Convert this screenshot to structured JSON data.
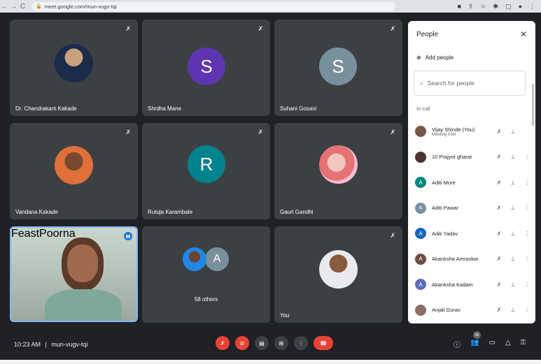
{
  "browser": {
    "url": "meet.google.com/mun-vugv-tqi",
    "back": "←",
    "forward": "→",
    "reload": "C"
  },
  "tiles": [
    {
      "name": "Dr. Chandrakant Kakade",
      "kind": "photo"
    },
    {
      "name": "Shrdha Mane",
      "kind": "letter",
      "letter": "S",
      "color": "#5e35b1"
    },
    {
      "name": "Suhani Gosavi",
      "kind": "letter",
      "letter": "S",
      "color": "#78909c"
    },
    {
      "name": "Vandana Kakade",
      "kind": "photo"
    },
    {
      "name": "Rutuja Karambale",
      "kind": "letter",
      "letter": "R",
      "color": "#00838f"
    },
    {
      "name": "Gauri Gandhi",
      "kind": "photo"
    },
    {
      "name": "FeastPoorna",
      "kind": "video"
    },
    {
      "name": "58 others",
      "kind": "group",
      "letter": "A",
      "color": "#78909c"
    },
    {
      "name": "You",
      "kind": "photo"
    }
  ],
  "people": {
    "title": "People",
    "add_label": "Add people",
    "search_placeholder": "Search for people",
    "section": "In call",
    "list": [
      {
        "name": "Vijay Shinde (You)",
        "sub": "Meeting host",
        "initial": "",
        "color": "#795548"
      },
      {
        "name": "10 Prajyot gharat",
        "sub": "",
        "initial": "",
        "color": "#4e342e"
      },
      {
        "name": "Aditi More",
        "sub": "",
        "initial": "A",
        "color": "#00897b"
      },
      {
        "name": "Aditi Pawar",
        "sub": "",
        "initial": "A",
        "color": "#78909c"
      },
      {
        "name": "Aditi Yadav",
        "sub": "",
        "initial": "A",
        "color": "#1565c0"
      },
      {
        "name": "Akanksha Amraskar",
        "sub": "",
        "initial": "A",
        "color": "#6d4c41"
      },
      {
        "name": "Akanksha Kadam",
        "sub": "",
        "initial": "A",
        "color": "#5c6bc0"
      },
      {
        "name": "Anjali Gurav",
        "sub": "",
        "initial": "",
        "color": "#8d6e63"
      }
    ]
  },
  "bottom": {
    "time": "10:23 AM",
    "separator": "|",
    "meeting_code": "mun-vugv-tqi",
    "participants_count": "66"
  },
  "colors": {
    "accent": "#8ab4f8",
    "end_call": "#ea4335",
    "tile_bg": "#3c4043"
  }
}
